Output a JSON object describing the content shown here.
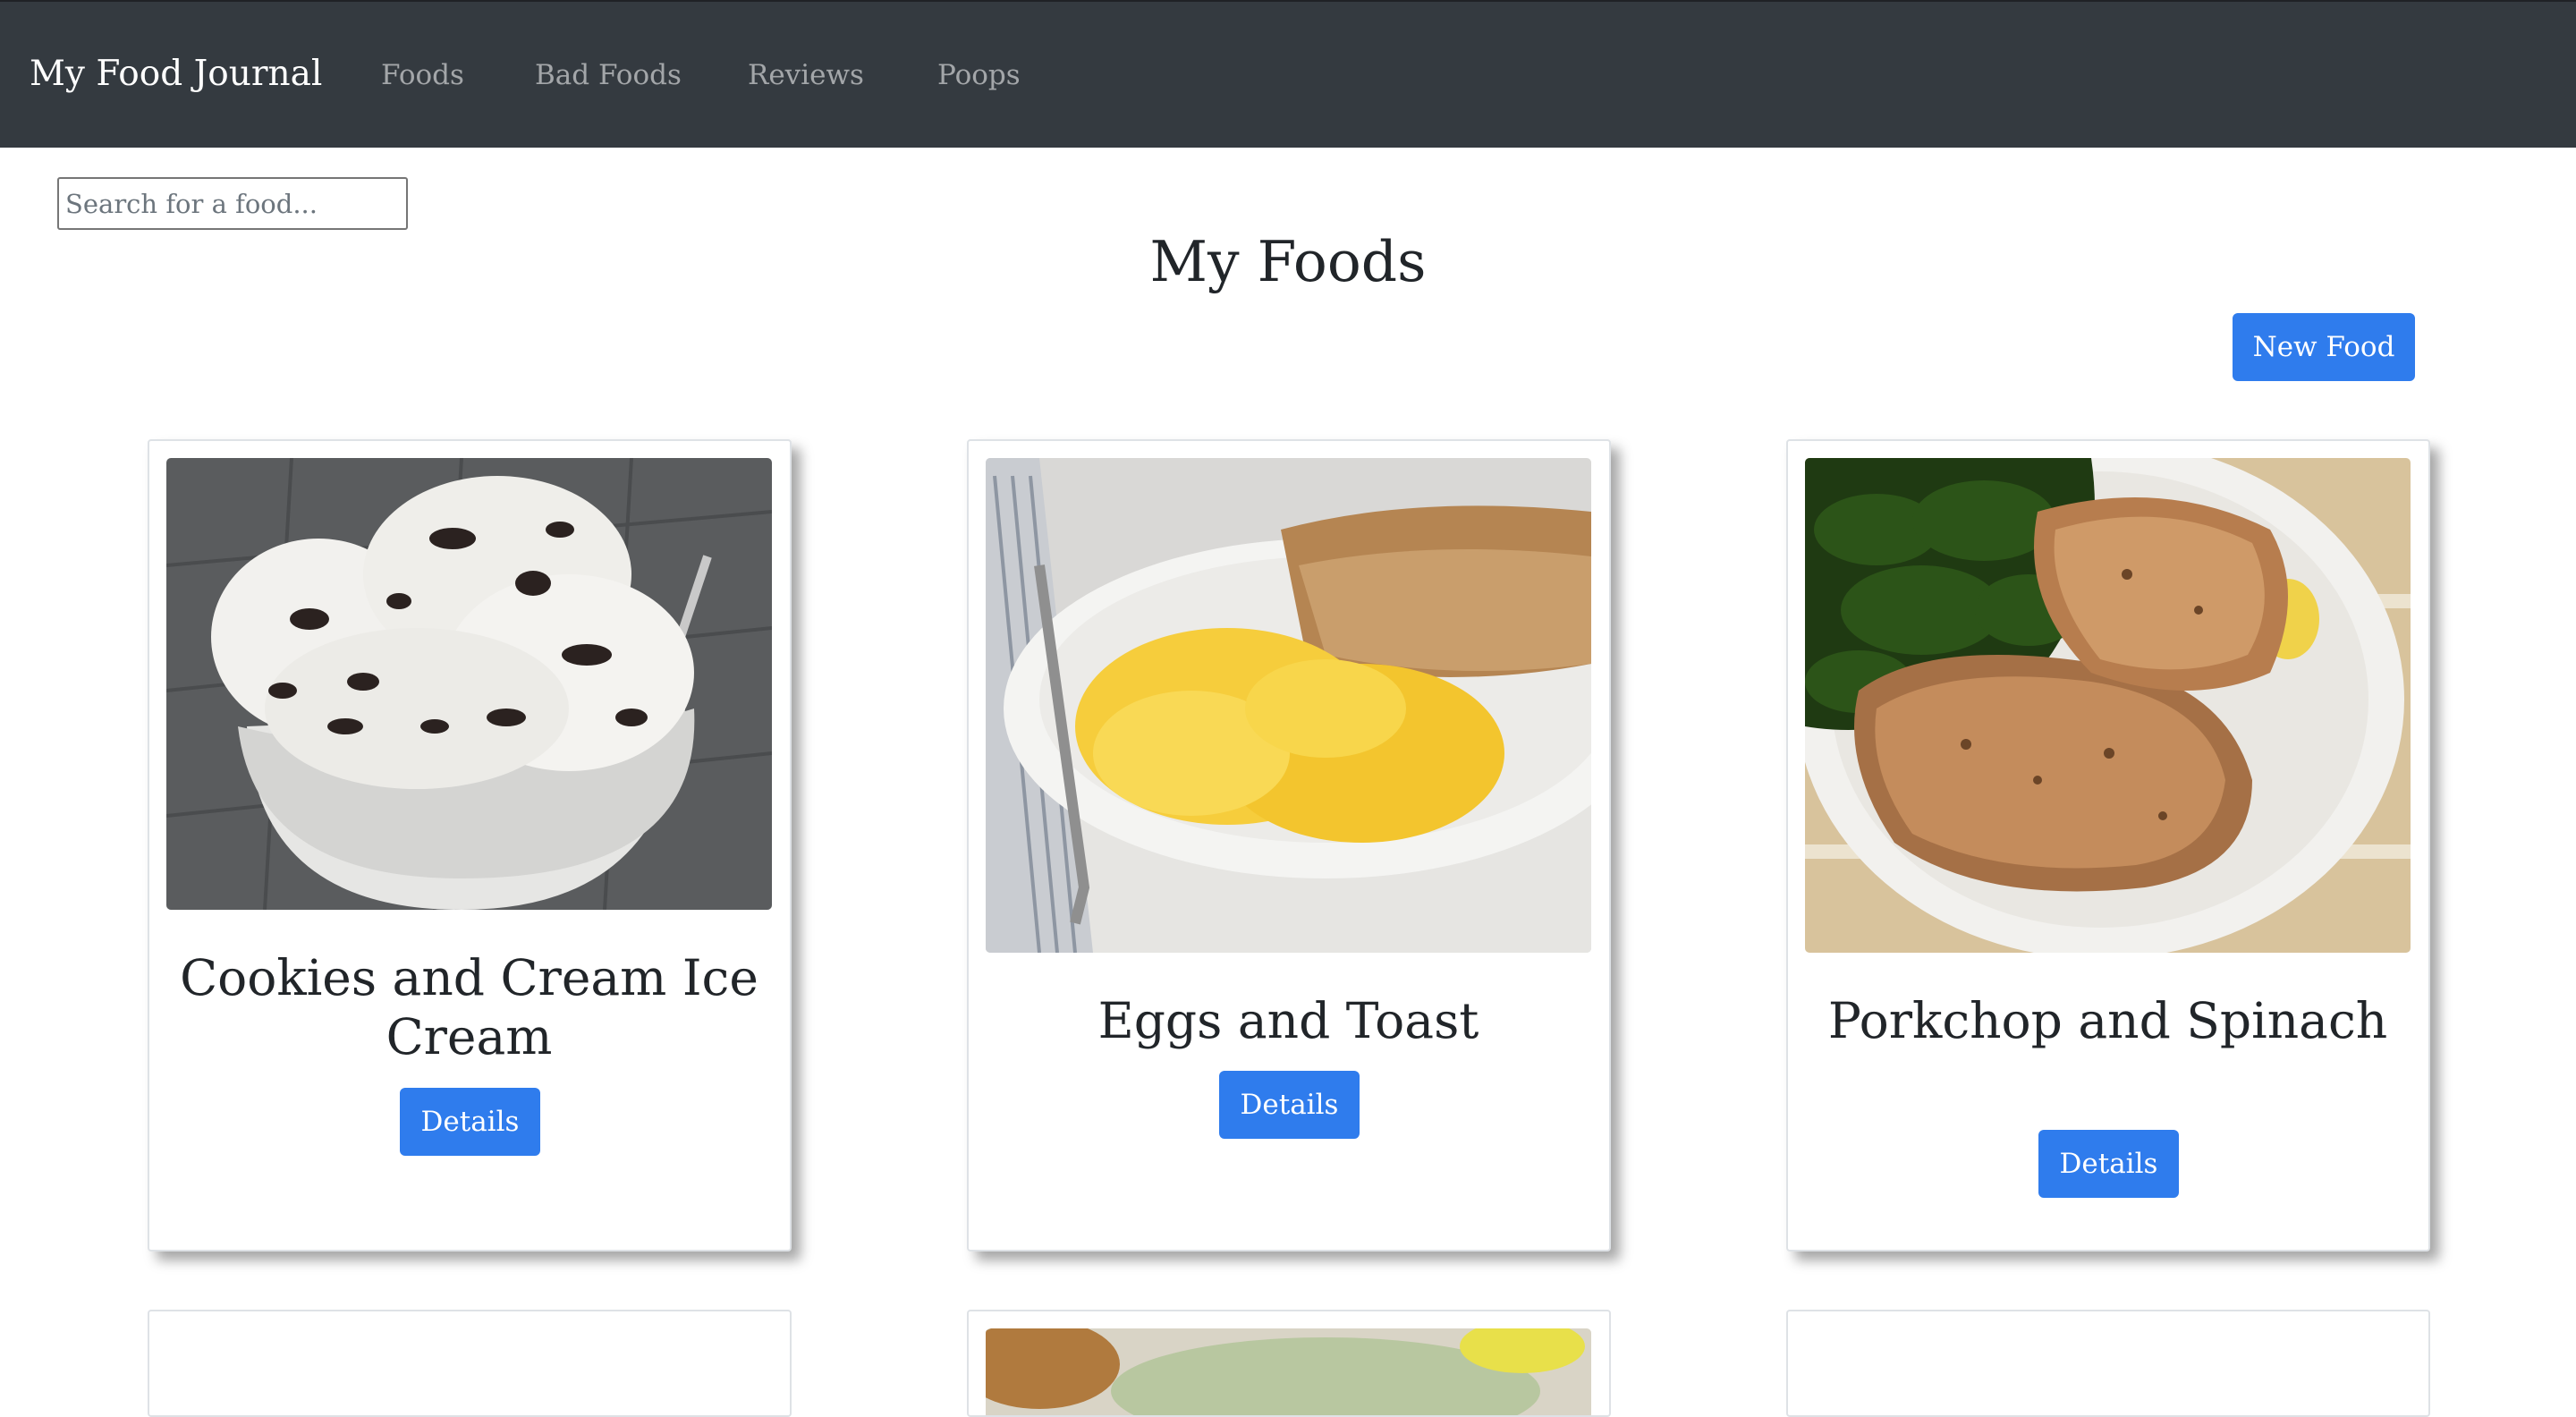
{
  "navbar": {
    "brand": "My Food Journal",
    "links": [
      "Foods",
      "Bad Foods",
      "Reviews",
      "Poops"
    ]
  },
  "search": {
    "placeholder": "Search for a food..."
  },
  "page": {
    "title": "My Foods",
    "new_food_label": "New Food"
  },
  "cards": [
    {
      "title": "Cookies and Cream Ice Cream",
      "details_label": "Details",
      "image": "cookies-and-cream-ice-cream-photo"
    },
    {
      "title": "Eggs and Toast",
      "details_label": "Details",
      "image": "eggs-and-toast-photo"
    },
    {
      "title": "Porkchop and Spinach",
      "details_label": "Details",
      "image": "porkchop-and-spinach-photo"
    }
  ],
  "colors": {
    "navbar_bg": "#343a40",
    "primary_button": "#2f7ced",
    "nav_link": "rgba(255,255,255,0.55)"
  }
}
